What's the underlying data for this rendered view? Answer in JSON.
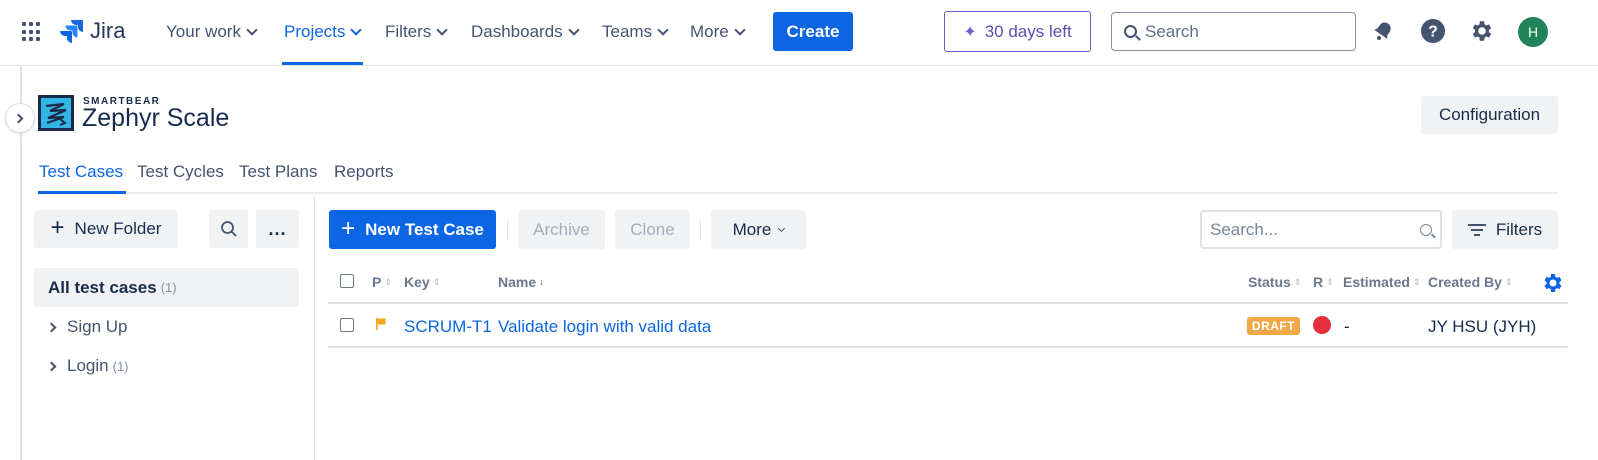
{
  "topnav": {
    "logo_text": "Jira",
    "items": [
      {
        "label": "Your work"
      },
      {
        "label": "Projects"
      },
      {
        "label": "Filters"
      },
      {
        "label": "Dashboards"
      },
      {
        "label": "Teams"
      },
      {
        "label": "More"
      }
    ],
    "active_item": "Projects",
    "create_label": "Create",
    "trial_label": "30 days left",
    "search_placeholder": "Search",
    "avatar_initial": "H",
    "colors": {
      "accent": "#0c66e4",
      "trial": "#6e5dc6",
      "avatar": "#1f845a"
    },
    "icons": [
      "app-switcher-icon",
      "jira-logo-icon",
      "sparkle-icon",
      "search-icon",
      "notifications-icon",
      "help-icon",
      "settings-icon"
    ]
  },
  "app": {
    "brand": "SMARTBEAR",
    "title": "Zephyr Scale",
    "configuration_label": "Configuration"
  },
  "tabs": [
    {
      "label": "Test Cases"
    },
    {
      "label": "Test Cycles"
    },
    {
      "label": "Test Plans"
    },
    {
      "label": "Reports"
    }
  ],
  "active_tab": "Test Cases",
  "folders": {
    "new_folder_label": "New Folder",
    "more_label": "...",
    "all_label": "All test cases",
    "all_count": "(1)",
    "items": [
      {
        "label": "Sign Up",
        "count": ""
      },
      {
        "label": "Login",
        "count": "(1)"
      }
    ]
  },
  "toolbar": {
    "new_test_case_label": "New Test Case",
    "archive_label": "Archive",
    "clone_label": "Clone",
    "more_label": "More",
    "search_placeholder": "Search...",
    "filters_label": "Filters"
  },
  "table": {
    "columns": {
      "priority": "P",
      "key": "Key",
      "name": "Name",
      "status": "Status",
      "result": "R",
      "estimated": "Estimated",
      "created_by": "Created By"
    },
    "rows": [
      {
        "priority_color": "#f5a623",
        "key": "SCRUM-T1",
        "name": "Validate login with valid data",
        "status": "DRAFT",
        "status_color": "#f0a746",
        "result_color": "#e2313b",
        "estimated": "-",
        "created_by": "JY HSU (JYH)"
      }
    ]
  }
}
